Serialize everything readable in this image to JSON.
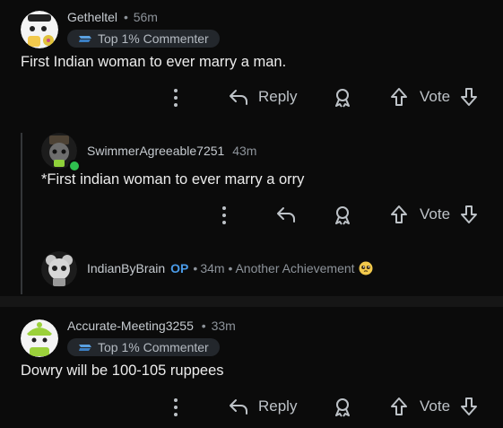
{
  "comments": [
    {
      "username": "Getheltel",
      "age": "56m",
      "badge": "Top 1% Commenter",
      "text": "First Indian woman to ever marry a man.",
      "reply_label": "Reply",
      "vote_label": "Vote"
    },
    {
      "username": "SwimmerAgreeable7251",
      "age": "43m",
      "text": "*First indian woman to ever marry a orry",
      "vote_label": "Vote"
    },
    {
      "username": "IndianByBrain",
      "op_label": "OP",
      "age": "34m",
      "flair": "Another Achievement"
    },
    {
      "username": "Accurate-Meeting3255",
      "age": "33m",
      "badge": "Top 1% Commenter",
      "text": "Dowry will be 100-105 ruppees",
      "reply_label": "Reply",
      "vote_label": "Vote"
    }
  ],
  "separators": {
    "dot": "•"
  },
  "colors": {
    "background": "#0b0b0b",
    "op_blue": "#4a9be8",
    "online_green": "#2fbf4f",
    "avatar_yellow": "#f2c94c",
    "avatar_green": "#9bd13b"
  }
}
